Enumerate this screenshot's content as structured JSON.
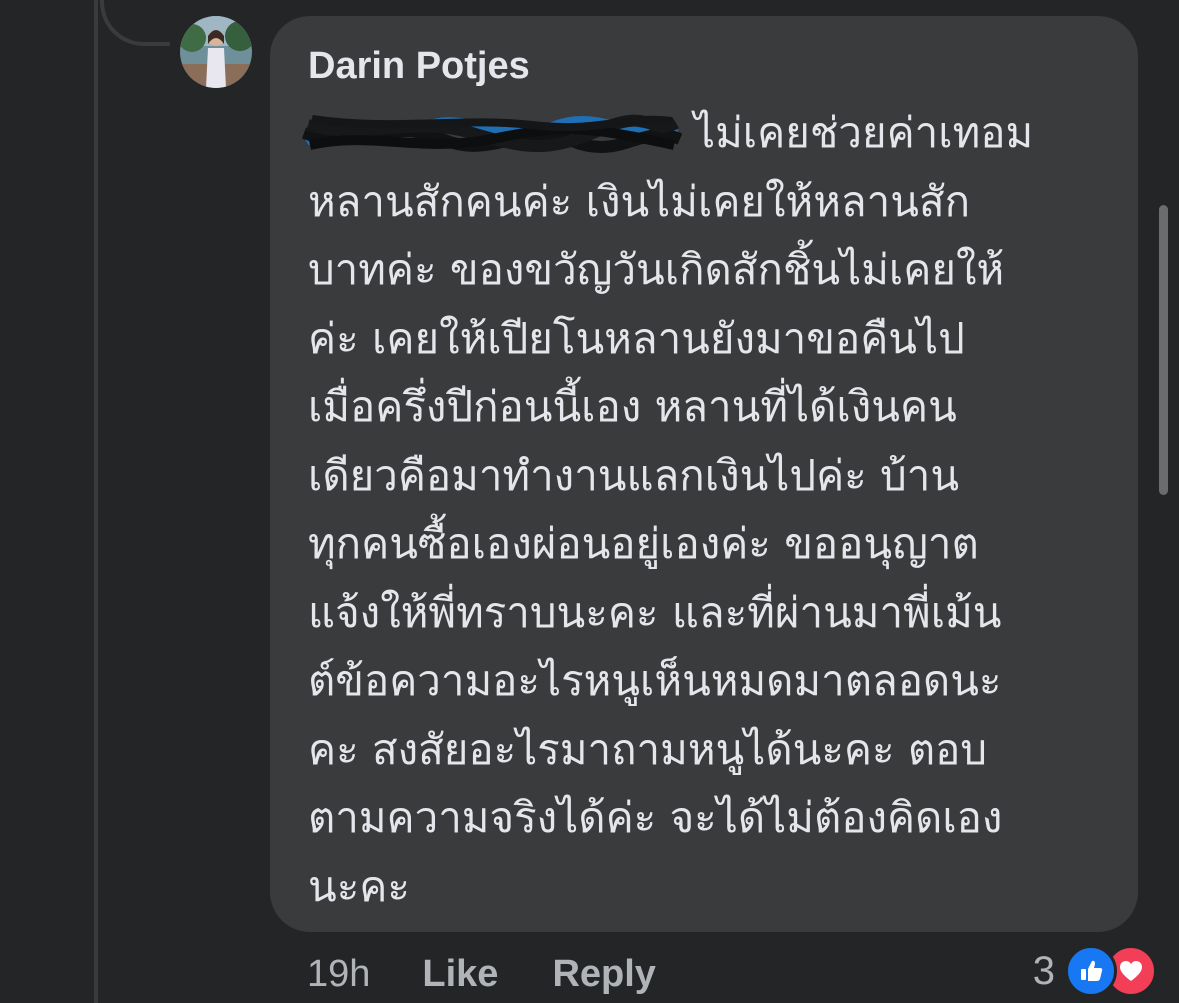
{
  "comment": {
    "author": "Darin Potjes",
    "first_line_text": "ไม่เคยช่วยค่าเทอม",
    "body_lines": [
      "หลานสักคนค่ะ เงินไม่เคยให้หลานสัก",
      "บาทค่ะ ของขวัญวันเกิดสักชิ้นไม่เคยให้",
      "ค่ะ เคยให้เปียโนหลานยังมาขอคืนไป",
      "เมื่อครึ่งปีก่อนนี้เอง หลานที่ได้เงินคน",
      "เดียวคือมาทำงานแลกเงินไปค่ะ บ้าน",
      "ทุกคนซื้อเองผ่อนอยู่เองค่ะ ขออนุญาต",
      "แจ้งให้พี่ทราบนะคะ และที่ผ่านมาพี่เม้น",
      "ต์ข้อความอะไรหนูเห็นหมดมาตลอดนะ",
      "คะ สงสัยอะไรมาถามหนูได้นะคะ ตอบ",
      "ตามความจริงได้ค่ะ จะได้ไม่ต้องคิดเอง",
      "นะคะ"
    ]
  },
  "actions": {
    "timestamp": "19h",
    "like_label": "Like",
    "reply_label": "Reply"
  },
  "reactions": {
    "count": "3",
    "types": [
      "like-icon",
      "love-icon"
    ]
  },
  "colors": {
    "background": "#242526",
    "bubble": "#3a3b3c",
    "text": "#e4e6eb",
    "secondary_text": "#b0b3b8",
    "like_blue": "#1877f2",
    "love_red": "#f33e58"
  }
}
